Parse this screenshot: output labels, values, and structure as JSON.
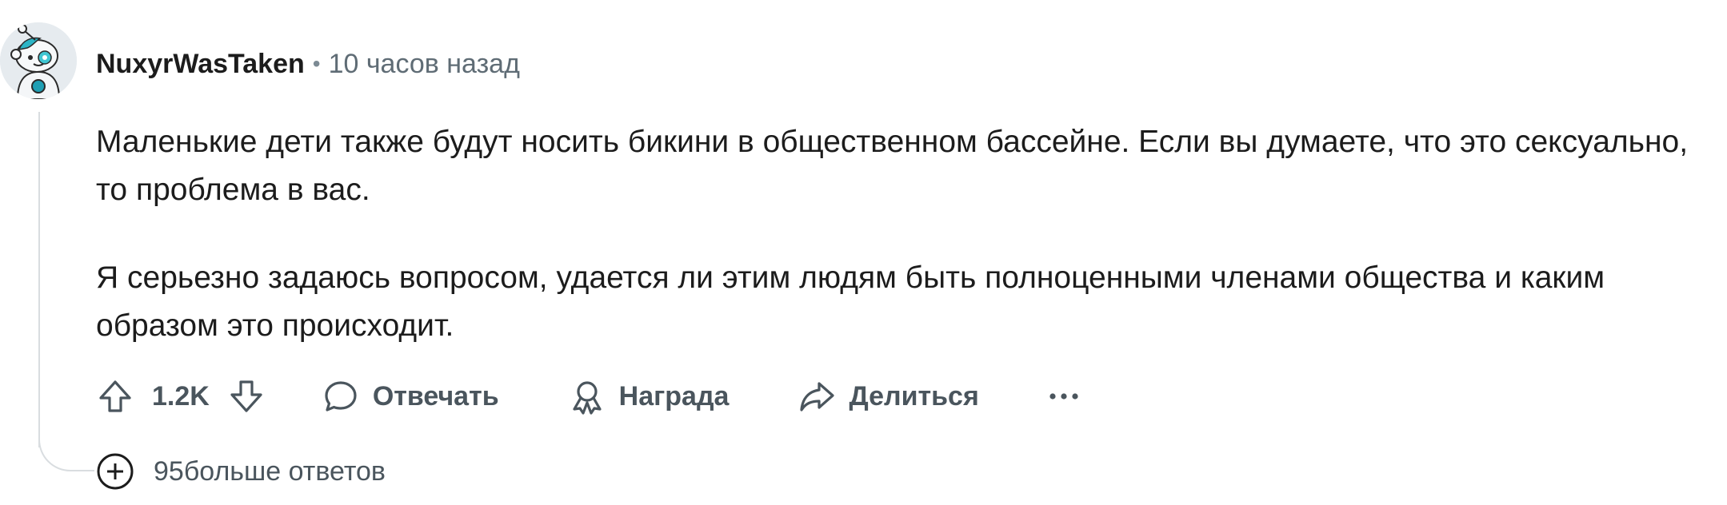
{
  "comment": {
    "author": "NuxyrWasTaken",
    "separator": "•",
    "time": "10 часов назад",
    "paragraphs": [
      "Маленькие дети также будут носить бикини в общественном бассейне. Если вы думаете, что это сексуально, то проблема в вас.",
      "Я серьезно задаюсь вопросом, удается ли этим людям быть полноценными членами общества и каким образом это происходит."
    ],
    "avatar_icon": "snoo-avatar-icon"
  },
  "actions": {
    "upvote_icon": "upvote-arrow-icon",
    "score": "1.2K",
    "downvote_icon": "downvote-arrow-icon",
    "reply_icon": "speech-bubble-icon",
    "reply_label": "Отвечать",
    "award_icon": "award-icon",
    "award_label": "Награда",
    "share_icon": "share-arrow-icon",
    "share_label": "Делиться",
    "more_icon": "ellipsis-icon",
    "more_label": "···"
  },
  "more_replies": {
    "icon": "plus-circle-icon",
    "label": "95больше ответов"
  },
  "colors": {
    "text": "#1c1c1c",
    "muted": "#5f6c75",
    "action": "#4a555d",
    "thread_line": "#d9dde0"
  }
}
